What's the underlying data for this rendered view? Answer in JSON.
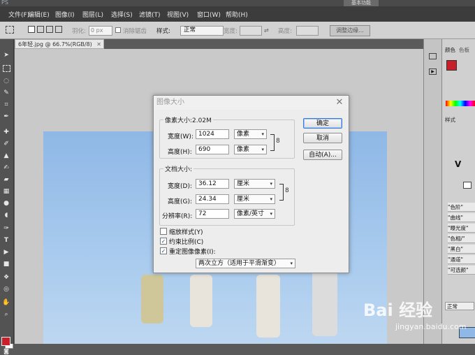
{
  "menu": {
    "app_glyph": "PS",
    "items": [
      "文件(F)",
      "编辑(E)",
      "图像(I)",
      "图层(L)",
      "选择(S)",
      "滤镜(T)",
      "视图(V)",
      "窗口(W)",
      "帮助(H)"
    ],
    "workspace_button": "基本功能"
  },
  "options": {
    "feather_label": "羽化:",
    "feather_value": "0 px",
    "antialias_label": "消除锯齿",
    "style_label": "样式:",
    "style_value": "正常",
    "width_label": "宽度:",
    "height_label": "高度:",
    "refine_edge": "调整边缘..."
  },
  "document": {
    "tab_title": "6年轻.jpg @ 66.7%(RGB/8)"
  },
  "panels": {
    "color_tab": "颜色",
    "swatches_tab": "色板",
    "styles_tab": "样式",
    "history_items": [
      "\"色阶\"",
      "\"曲线\"",
      "\"曝光度\"",
      "\"色相/\"",
      "\"黑白\"",
      "\"通道\"",
      "\"可选颜\""
    ],
    "blend_mode": "正常"
  },
  "dialog": {
    "title": "图像大小",
    "close_glyph": "✕",
    "pixel_dimensions_label": "像素大小:2.02M",
    "pixel_width_label": "宽度(W):",
    "pixel_width_value": "1024",
    "pixel_width_unit": "像素",
    "pixel_height_label": "高度(H):",
    "pixel_height_value": "690",
    "pixel_height_unit": "像素",
    "document_size_label": "文档大小:",
    "doc_width_label": "宽度(D):",
    "doc_width_value": "36.12",
    "doc_width_unit": "厘米",
    "doc_height_label": "高度(G):",
    "doc_height_value": "24.34",
    "doc_height_unit": "厘米",
    "resolution_label": "分辨率(R):",
    "resolution_value": "72",
    "resolution_unit": "像素/英寸",
    "scale_styles_label": "缩放样式(Y)",
    "scale_styles_checked": false,
    "constrain_label": "约束比例(C)",
    "constrain_checked": true,
    "resample_label": "重定图像像素(I):",
    "resample_checked": true,
    "resample_method": "两次立方（适用于平滑渐变）",
    "ok_button": "确定",
    "cancel_button": "取消",
    "auto_button": "自动(A)...",
    "check_glyph": "✓",
    "caret_glyph": "▾",
    "chain_glyph": "8"
  },
  "watermark": {
    "brand": "Bai 经验",
    "url": "jingyan.baidu.com"
  },
  "colors": {
    "foreground": "#c8202a",
    "accent": "#3a7bd5"
  }
}
